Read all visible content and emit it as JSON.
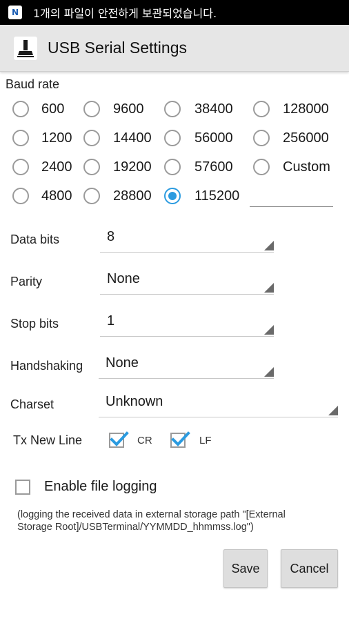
{
  "status_bar": {
    "notification_icon_letter": "N",
    "notification_text": "1개의 파일이 안전하게 보관되었습니다."
  },
  "action_bar": {
    "title": "USB Serial Settings",
    "app_icon": "usb-terminal-icon"
  },
  "baud_rate": {
    "label": "Baud rate",
    "selected": "115200",
    "options": [
      "600",
      "9600",
      "38400",
      "128000",
      "1200",
      "14400",
      "56000",
      "256000",
      "2400",
      "19200",
      "57600",
      "Custom",
      "4800",
      "28800",
      "115200"
    ],
    "custom_value": ""
  },
  "settings": {
    "data_bits": {
      "label": "Data bits",
      "value": "8"
    },
    "parity": {
      "label": "Parity",
      "value": "None"
    },
    "stop_bits": {
      "label": "Stop bits",
      "value": "1"
    },
    "handshaking": {
      "label": "Handshaking",
      "value": "None"
    },
    "charset": {
      "label": "Charset",
      "value": "Unknown"
    }
  },
  "tx_new_line": {
    "label": "Tx New Line",
    "cr": {
      "label": "CR",
      "checked": true
    },
    "lf": {
      "label": "LF",
      "checked": true
    }
  },
  "file_logging": {
    "label": "Enable file logging",
    "checked": false,
    "note": "(logging the received data in external storage path \"[External Storage Root]/USBTerminal/YYMMDD_hhmmss.log\")",
    "note_line1": "(logging the received data in external storage path \"[External",
    "note_line2": "Storage Root]/USBTerminal/YYMMDD_hhmmss.log\")"
  },
  "buttons": {
    "save": "Save",
    "cancel": "Cancel"
  },
  "colors": {
    "accent": "#2b9be0",
    "action_bar": "#e6e6e6",
    "status_bar": "#000000"
  }
}
